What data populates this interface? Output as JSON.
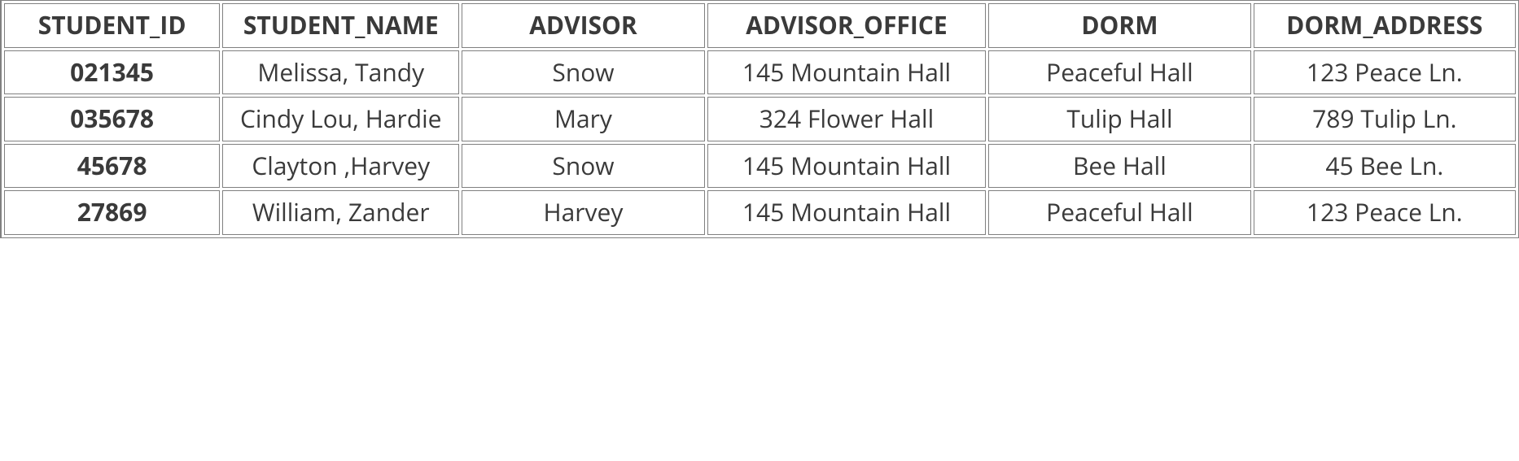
{
  "table": {
    "headers": {
      "student_id": "STUDENT_ID",
      "student_name": "STUDENT_NAME",
      "advisor": "ADVISOR",
      "advisor_office": "ADVISOR_OFFICE",
      "dorm": "DORM",
      "dorm_address": "DORM_ADDRESS"
    },
    "rows": [
      {
        "student_id": "021345",
        "student_name": "Melissa, Tandy",
        "advisor": "Snow",
        "advisor_office": "145 Mountain Hall",
        "dorm": "Peaceful Hall",
        "dorm_address": "123 Peace Ln."
      },
      {
        "student_id": "035678",
        "student_name": "Cindy Lou, Hardie",
        "advisor": "Mary",
        "advisor_office": "324 Flower Hall",
        "dorm": "Tulip Hall",
        "dorm_address": "789 Tulip Ln."
      },
      {
        "student_id": "45678",
        "student_name": "Clayton ,Harvey",
        "advisor": "Snow",
        "advisor_office": "145 Mountain Hall",
        "dorm": "Bee Hall",
        "dorm_address": "45 Bee Ln."
      },
      {
        "student_id": "27869",
        "student_name": "William, Zander",
        "advisor": "Harvey",
        "advisor_office": "145 Mountain Hall",
        "dorm": "Peaceful Hall",
        "dorm_address": "123 Peace Ln."
      }
    ]
  }
}
